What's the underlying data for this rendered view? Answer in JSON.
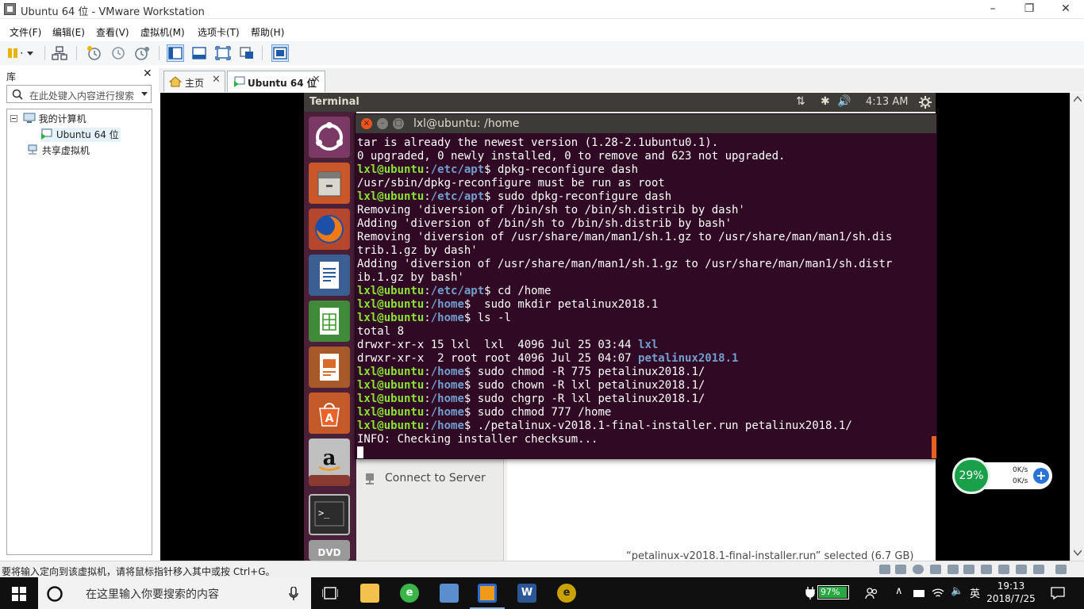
{
  "window": {
    "title": "Ubuntu 64 位 - VMware Workstation",
    "controls": [
      "–",
      "❐",
      "✕"
    ]
  },
  "menu": [
    "文件(F)",
    "编辑(E)",
    "查看(V)",
    "虚拟机(M)",
    "选项卡(T)",
    "帮助(H)"
  ],
  "library": {
    "title": "库",
    "close": "✕",
    "search_placeholder": "在此处键入内容进行搜索",
    "tree": {
      "root": "我的计算机",
      "vm": "Ubuntu 64 位",
      "shared": "共享虚拟机"
    }
  },
  "tabs": [
    {
      "label": "主页",
      "close": "✕"
    },
    {
      "label": "Ubuntu 64 位",
      "close": "✕"
    }
  ],
  "guest": {
    "topbar_title": "Terminal",
    "indicators": [
      "⇅",
      "✱",
      "🔊"
    ],
    "clock": "4:13 AM",
    "launcher_icons": [
      "ubuntu-dash-icon",
      "files-icon",
      "firefox-icon",
      "writer-icon",
      "calc-icon",
      "impress-icon",
      "software-center-icon",
      "amazon-icon",
      "settings-icon",
      "terminal-icon",
      "dvd-icon"
    ],
    "nautilus": {
      "connect_to_server": "Connect to Server",
      "status": "“petalinux-v2018.1-final-installer.run” selected  (6.7 GB)"
    },
    "terminal": {
      "title": "lxl@ubuntu: /home",
      "user": "lxl@ubuntu",
      "lines": [
        {
          "t": "text",
          "text": "tar is already the newest version (1.28-2.1ubuntu0.1)."
        },
        {
          "t": "text",
          "text": "0 upgraded, 0 newly installed, 0 to remove and 623 not upgraded."
        },
        {
          "t": "prompt",
          "path": "/etc/apt",
          "cmd": " dpkg-reconfigure dash"
        },
        {
          "t": "text",
          "text": "/usr/sbin/dpkg-reconfigure must be run as root"
        },
        {
          "t": "prompt",
          "path": "/etc/apt",
          "cmd": " sudo dpkg-reconfigure dash"
        },
        {
          "t": "text",
          "text": "Removing 'diversion of /bin/sh to /bin/sh.distrib by dash'"
        },
        {
          "t": "text",
          "text": "Adding 'diversion of /bin/sh to /bin/sh.distrib by bash'"
        },
        {
          "t": "text",
          "text": "Removing 'diversion of /usr/share/man/man1/sh.1.gz to /usr/share/man/man1/sh.dis"
        },
        {
          "t": "text",
          "text": "trib.1.gz by dash'"
        },
        {
          "t": "text",
          "text": "Adding 'diversion of /usr/share/man/man1/sh.1.gz to /usr/share/man/man1/sh.distr"
        },
        {
          "t": "text",
          "text": "ib.1.gz by bash'"
        },
        {
          "t": "prompt",
          "path": "/etc/apt",
          "cmd": " cd /home"
        },
        {
          "t": "prompt",
          "path": "/home",
          "cmd": "  sudo mkdir petalinux2018.1"
        },
        {
          "t": "prompt",
          "path": "/home",
          "cmd": " ls -l"
        },
        {
          "t": "text",
          "text": "total 8"
        },
        {
          "t": "ls",
          "text": "drwxr-xr-x 15 lxl  lxl  4096 Jul 25 03:44 ",
          "name": "lxl"
        },
        {
          "t": "ls",
          "text": "drwxr-xr-x  2 root root 4096 Jul 25 04:07 ",
          "name": "petalinux2018.1"
        },
        {
          "t": "prompt",
          "path": "/home",
          "cmd": " sudo chmod -R 775 petalinux2018.1/"
        },
        {
          "t": "prompt",
          "path": "/home",
          "cmd": " sudo chown -R lxl petalinux2018.1/"
        },
        {
          "t": "prompt",
          "path": "/home",
          "cmd": " sudo chgrp -R lxl petalinux2018.1/"
        },
        {
          "t": "prompt",
          "path": "/home",
          "cmd": " sudo chmod 777 /home"
        },
        {
          "t": "prompt",
          "path": "/home",
          "cmd": " ./petalinux-v2018.1-final-installer.run petalinux2018.1/"
        },
        {
          "t": "text",
          "text": "INFO: Checking installer checksum..."
        },
        {
          "t": "cursor"
        }
      ]
    }
  },
  "net_widget": {
    "percent": "29%",
    "up": "0K/s",
    "down": "0K/s"
  },
  "statusbar": {
    "message": "要将输入定向到该虚拟机，请将鼠标指针移入其中或按 Ctrl+G。"
  },
  "taskbar": {
    "search_placeholder": "在这里输入你要搜索的内容",
    "battery": "97%",
    "ime": "英",
    "time": "19:13",
    "date": "2018/7/25"
  },
  "colors": {
    "terminal_bg": "#300a24",
    "launcher_bg": "#4a2038",
    "prompt_user": "#8ae234",
    "prompt_path": "#729fcf",
    "accent": "#0078d7"
  }
}
